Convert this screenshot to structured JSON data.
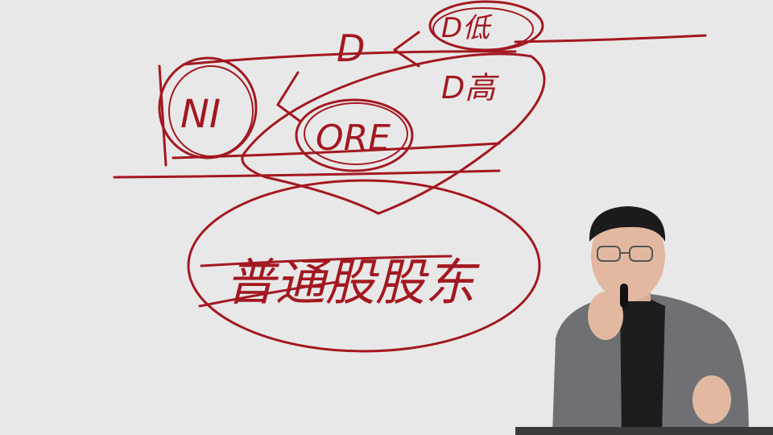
{
  "whiteboard": {
    "background": "#e8e8e8",
    "ink_color": "#a31820",
    "labels": {
      "ni": "NI",
      "d_top": "D",
      "d_low": "D低",
      "d_high": "D高",
      "ore": "ORE",
      "bottom_phrase": "普通股股东"
    }
  },
  "presenter": {
    "description_icon": "person-speaking-icon",
    "jacket_color": "#6f7073",
    "shirt_color": "#1c1c1e",
    "skin_color": "#e2b9a0",
    "hair_color": "#1b1b1d"
  },
  "podium": {
    "color": "#3a3a3c"
  }
}
